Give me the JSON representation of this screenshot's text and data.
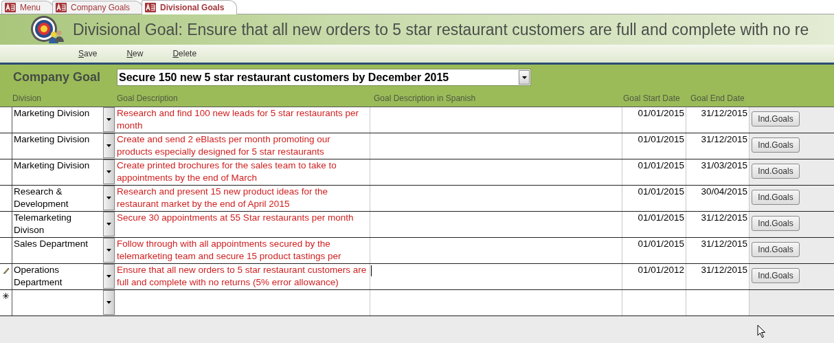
{
  "tabs": [
    {
      "label": "Menu",
      "selected": false
    },
    {
      "label": "Company Goals",
      "selected": false
    },
    {
      "label": "Divisional Goals",
      "selected": true
    }
  ],
  "form": {
    "title": "Divisional Goal: Ensure that all new orders to 5 star restaurant customers are full and complete with no re"
  },
  "toolbar": [
    "Save",
    "New",
    "Delete"
  ],
  "company_goal": {
    "label": "Company Goal",
    "value": "Secure 150 new 5 star restaurant customers by December 2015"
  },
  "columns": [
    "Division",
    "Goal Description",
    "Goal Description in Spanish",
    "Goal Start Date",
    "Goal End Date"
  ],
  "rows": [
    {
      "kind": "record",
      "editing": false,
      "division": "Marketing Division",
      "description": "Research and find 100 new leads for 5 star restaurants per month",
      "start": "01/01/2015",
      "end": "31/12/2015",
      "button": "Ind.Goals"
    },
    {
      "kind": "record",
      "editing": false,
      "division": "Marketing Division",
      "description": "Create and send 2 eBlasts per month promoting our products especially designed for 5 star restaurants",
      "start": "01/01/2015",
      "end": "31/12/2015",
      "button": "Ind.Goals"
    },
    {
      "kind": "record",
      "editing": false,
      "division": "Marketing Division",
      "description": "Create printed brochures for the sales team to take to appointments by the end of March",
      "start": "01/01/2015",
      "end": "31/03/2015",
      "button": "Ind.Goals"
    },
    {
      "kind": "record",
      "editing": false,
      "division": "Research & Development",
      "description": "Research and present 15 new product ideas for the restaurant market by the end of April 2015",
      "start": "01/01/2015",
      "end": "30/04/2015",
      "button": "Ind.Goals"
    },
    {
      "kind": "record",
      "editing": false,
      "division": "Telemarketing Divison",
      "description": "Secure 30 appointments at 55 Star restaurants per month",
      "start": "01/01/2015",
      "end": "31/12/2015",
      "button": "Ind.Goals"
    },
    {
      "kind": "record",
      "editing": false,
      "division": "Sales Department",
      "description": "Follow through with all appointments secured by the telemarketing team and secure 15 product tastings per",
      "start": "01/01/2015",
      "end": "31/12/2015",
      "button": "Ind.Goals"
    },
    {
      "kind": "record",
      "editing": true,
      "division": "Operations Department",
      "description": "Ensure that all new orders to 5 star restaurant customers are full and complete with no returns (5% error allowance)",
      "start": "01/01/2012",
      "end": "31/12/2015",
      "button": "Ind.Goals"
    },
    {
      "kind": "new"
    }
  ]
}
